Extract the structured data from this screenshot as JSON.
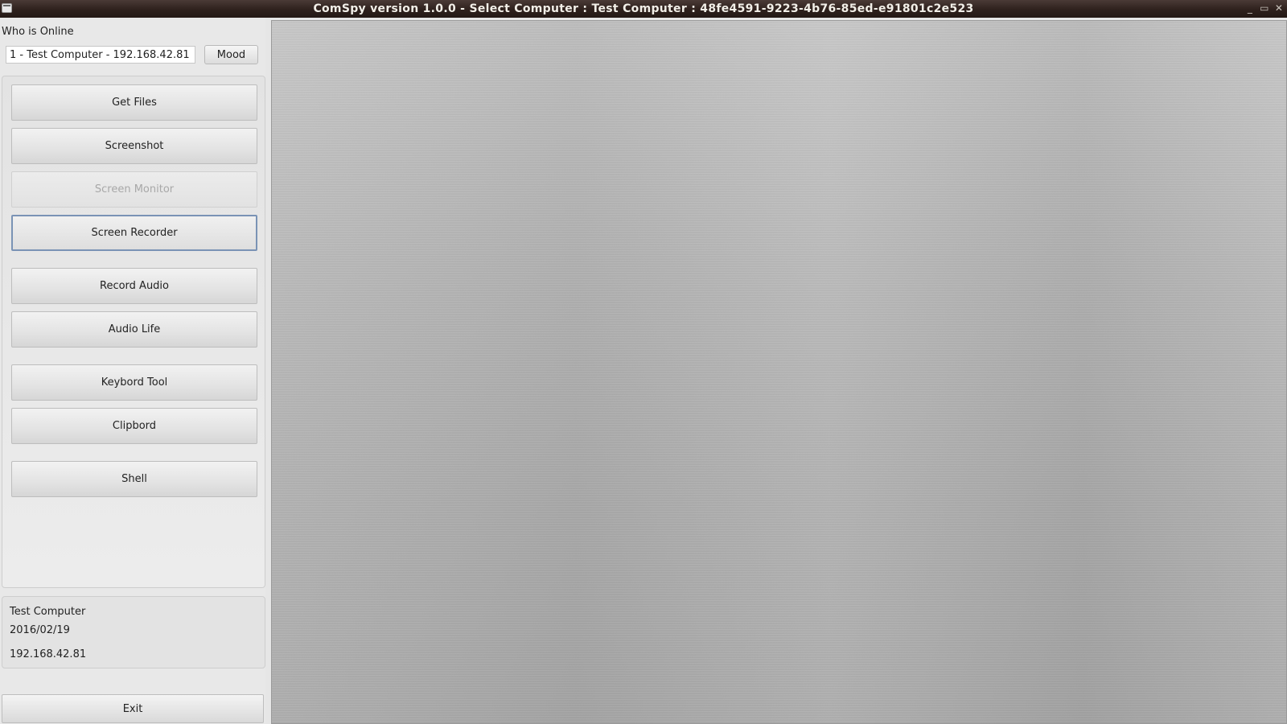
{
  "window": {
    "title": "ComSpy version 1.0.0  - Select Computer : Test Computer : 48fe4591-9223-4b76-85ed-e91801c2e523",
    "controls": {
      "minimize": "_",
      "restore": "▭",
      "close": "✕"
    }
  },
  "sidebar": {
    "who_online_label": "Who is Online",
    "selected_computer": "1 - Test Computer - 192.168.42.81",
    "mood_label": "Mood",
    "buttons": {
      "get_files": "Get Files",
      "screenshot": "Screenshot",
      "screen_monitor": "Screen Monitor",
      "screen_recorder": "Screen Recorder",
      "record_audio": "Record Audio",
      "audio_life": "Audio Life",
      "keybord_tool": "Keybord Tool",
      "clipbord": "Clipbord",
      "shell": "Shell"
    },
    "info": {
      "name": "Test Computer",
      "date": "2016/02/19",
      "ip": "192.168.42.81"
    },
    "exit_label": "Exit"
  },
  "colors": {
    "titlebar": "#2e211d",
    "focus_border": "#7a93b5",
    "main_background": "#b4b4b4"
  }
}
